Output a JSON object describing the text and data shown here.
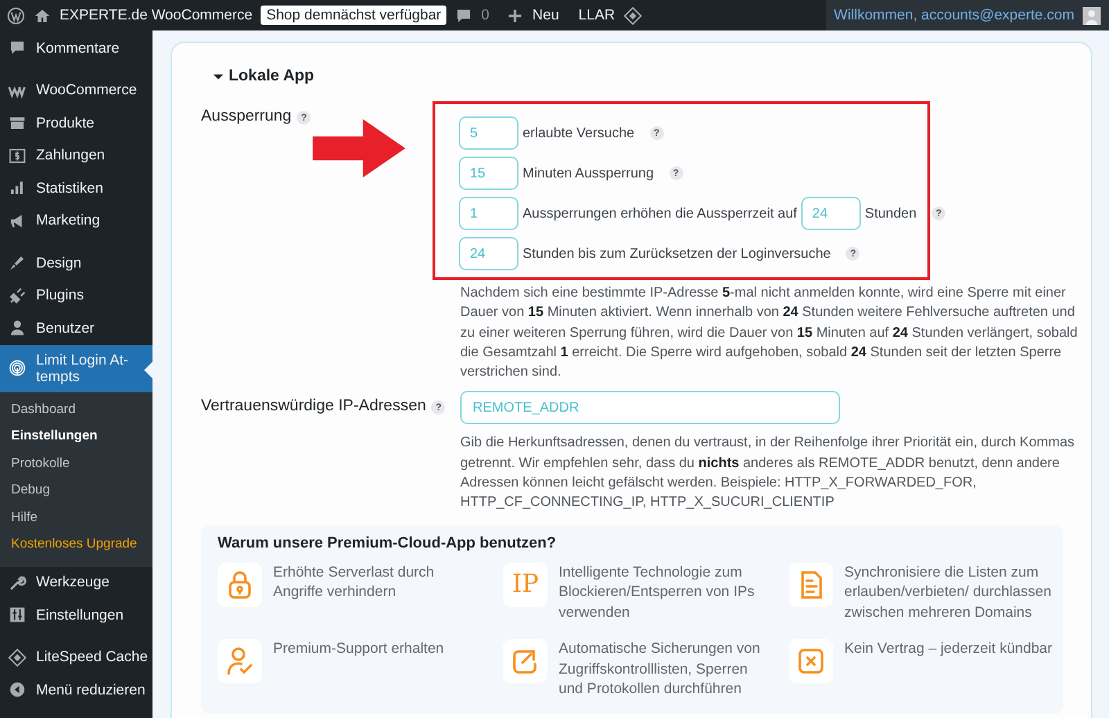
{
  "admin_bar": {
    "site_name": "EXPERTE.de WooCommerce",
    "badge": "Shop demnächst verfügbar",
    "comments": "0",
    "new_label": "Neu",
    "plugin_label": "LLAR",
    "greeting": "Willkommen, accounts@experte.com"
  },
  "sidebar": {
    "groups": [
      [
        {
          "label": "Kommentare",
          "kind": "comment",
          "selected": false
        }
      ],
      [
        {
          "label": "WooCommerce",
          "kind": "w",
          "selected": false
        },
        {
          "label": "Produkte",
          "kind": "box",
          "selected": false
        },
        {
          "label": "Zahlungen",
          "kind": "dollar",
          "selected": false
        },
        {
          "label": "Statistiken",
          "kind": "chart",
          "selected": false
        },
        {
          "label": "Marketing",
          "kind": "megaphone",
          "selected": false
        }
      ],
      [
        {
          "label": "Design",
          "kind": "brush",
          "selected": false
        },
        {
          "label": "Plugins",
          "kind": "plug",
          "selected": false
        },
        {
          "label": "Benutzer",
          "kind": "user",
          "selected": false
        },
        {
          "label": "Limit Login At-tempts",
          "kind": "fingerprint",
          "selected": true,
          "children": [
            {
              "label": "Dashboard",
              "kind": "normal",
              "selected": false
            },
            {
              "label": "Einstellungen",
              "kind": "normal",
              "selected": true
            },
            {
              "label": "Protokolle",
              "kind": "normal",
              "selected": false
            },
            {
              "label": "Debug",
              "kind": "normal",
              "selected": false
            },
            {
              "label": "Hilfe",
              "kind": "normal",
              "selected": false
            },
            {
              "label": "Kostenloses Upgrade",
              "kind": "upgrade",
              "selected": false
            }
          ]
        },
        {
          "label": "Werkzeuge",
          "kind": "wrench",
          "selected": false
        },
        {
          "label": "Einstellungen",
          "kind": "sliders",
          "selected": false
        }
      ],
      [
        {
          "label": "LiteSpeed Cache",
          "kind": "diamond",
          "selected": false
        },
        {
          "label": "Menü reduzieren",
          "kind": "collapse",
          "selected": false
        }
      ]
    ]
  },
  "section": {
    "title": "Lokale App",
    "expanded": true
  },
  "lockout": {
    "label": "Aussperrung",
    "help": "?",
    "rows": [
      {
        "value": "5",
        "text": "erlaubte Versuche",
        "help": "?"
      },
      {
        "value": "15",
        "text": "Minuten Aussperrung",
        "help": "?"
      },
      {
        "value": "1",
        "text": "Aussperrungen erhöhen die Aussperrzeit auf",
        "value_2": "24",
        "text_2": "Stunden",
        "help": "?"
      },
      {
        "value": "24",
        "text": "Stunden bis zum Zurücksetzen der Loginversuche",
        "help": "?"
      }
    ],
    "description": "Nachdem sich eine bestimmte IP-Adresse **5**-mal nicht anmelden konnte, wird eine Sperre mit einer Dauer von **15** Minuten aktiviert. Wenn innerhalb von **24** Stunden weitere Fehlversuche auftreten und zu einer weiteren Sperrung führen, wird die Dauer von **15** Minuten auf **24** Stunden verlängert, sobald die Gesamtzahl **1** erreicht. Die Sperre wird aufgehoben, sobald **24** Stunden seit der letzten Sperre verstrichen sind."
  },
  "trusted_ips": {
    "label": "Vertrauenswürdige IP-Adressen",
    "help": "?",
    "value": "REMOTE_ADDR",
    "description": "Gib die Herkunftsadressen, denen du vertraust, in der Reihenfolge ihrer Priorität ein, durch Kommas getrennt. Wir empfehlen sehr, dass du **nichts** anderes als REMOTE_ADDR benutzt, denn andere Adressen können leicht gefälscht werden. Beispiele: HTTP_X_FORWARDED_FOR, HTTP_CF_CONNECTING_IP, HTTP_X_SUCURI_CLIENTIP"
  },
  "premium": {
    "title": "Warum unsere Premium-Cloud-App benutzen?",
    "features": [
      {
        "kind": "lock",
        "text": "Erhöhte Serverlast durch Angriffe verhindern"
      },
      {
        "kind": "text",
        "icon_text": "IP",
        "text": "Intelligente Technologie zum Blockieren/Entsperren von IPs verwenden"
      },
      {
        "kind": "document",
        "text": "Synchronisiere die Listen zum erlauben/verbieten/ durchlassen zwischen mehreren Domains"
      },
      {
        "kind": "support",
        "text": "Premium-Support erhalten"
      },
      {
        "kind": "share",
        "text": "Automatische Sicherungen von Zugriffskontrolllisten, Sperren und Protokollen durchführen"
      },
      {
        "kind": "cancel",
        "text": "Kein Vertrag – jederzeit kündbar"
      }
    ]
  }
}
